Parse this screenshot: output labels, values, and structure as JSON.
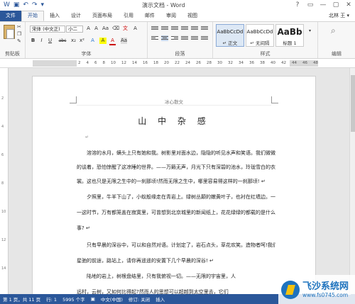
{
  "window": {
    "title": "演示文档 - Word",
    "controls": [
      "?",
      "▭",
      "—",
      "▢",
      "✕"
    ],
    "user": "北林 王 ▾"
  },
  "qat": {
    "icons": [
      "word-icon",
      "save-icon",
      "undo-icon",
      "redo-icon",
      "customize-icon"
    ],
    "glyphs": [
      "W",
      "▣",
      "↶",
      "↷",
      "▾"
    ]
  },
  "tabs": [
    "文件",
    "开始",
    "插入",
    "设计",
    "页面布局",
    "引用",
    "邮件",
    "审阅",
    "视图"
  ],
  "active_tab": "开始",
  "ribbon": {
    "clipboard": {
      "label": "剪贴板",
      "paste": "粘贴"
    },
    "font": {
      "label": "字体",
      "name": "宋体 (中文正)",
      "size": "小二",
      "buttons": [
        "B",
        "I",
        "U",
        "abc",
        "x₂",
        "x²",
        "A",
        "A",
        "Aa",
        "A"
      ]
    },
    "paragraph": {
      "label": "段落"
    },
    "styles": {
      "label": "样式",
      "items": [
        {
          "sample": "AaBbCcDd",
          "name": "↵ 正文"
        },
        {
          "sample": "AaBbCcDd",
          "name": "↵ 无间隔"
        },
        {
          "sample": "AaBb",
          "name": "标题 1"
        }
      ]
    },
    "editing": {
      "label": "编辑"
    }
  },
  "ruler": {
    "marks": [
      "2",
      "4",
      "6",
      "8",
      "10",
      "12",
      "14",
      "16",
      "18",
      "20",
      "22",
      "24",
      "26",
      "28",
      "30",
      "32",
      "34",
      "36",
      "38",
      "40",
      "42",
      "44",
      "46",
      "48"
    ]
  },
  "vruler": {
    "marks": [
      "2",
      "4",
      "6",
      "8",
      "10",
      "12",
      "14"
    ]
  },
  "document": {
    "header": "冰心散文",
    "title": "山 中 杂 感",
    "paragraphs": [
      "溶溶的水月，螨头上只有她和我。树影里对面水边，隐隐的听见水声和笑语。我们微微",
      "的谈着，恐怕惊醒了这凉睡的世界。——万籁无声，月光下只有深碧的池水，玲珑雪白的衣",
      "裳。这也只是无限之生中的一刹那顷!然而无限之生中，哪里容易得这样的一刹那顷! ↵",
      "夕照里，牛羊下山了，小蚁般缘走在青岩上。绿树丛颠的嫩黄叶子，也衬在红墙边。一",
      "一这时节，万有都笼盖在寂寞里，可曾想到北京城里的新闻纸上，花花绿绿的都载的是什么",
      "事? ↵",
      "只有早晨的深谷中，可以和自然对语。计划定了，岩石点头，草花欢笑。造物者呵!我们",
      "星驰的前途，路站上，请你再遥遥的安置下几个早晨的深谷! ↵",
      "陆地的岩上，树根盘结里，只有我俯视一切。——无限的宇宙里，人",
      "远村，云树，又如何比得起?然而人的思想可以超越到太空里去，它们"
    ]
  },
  "status": {
    "page": "第 1 页，共 11 页",
    "row": "行: 1",
    "words": "5995 个字",
    "lang": "中文(中国)",
    "revise": "修订: 关闭",
    "insert": "插入",
    "zoom": "— ━━━━ +"
  },
  "watermark": {
    "cn": "飞沙系统网",
    "url": "www.fs0745.com"
  }
}
